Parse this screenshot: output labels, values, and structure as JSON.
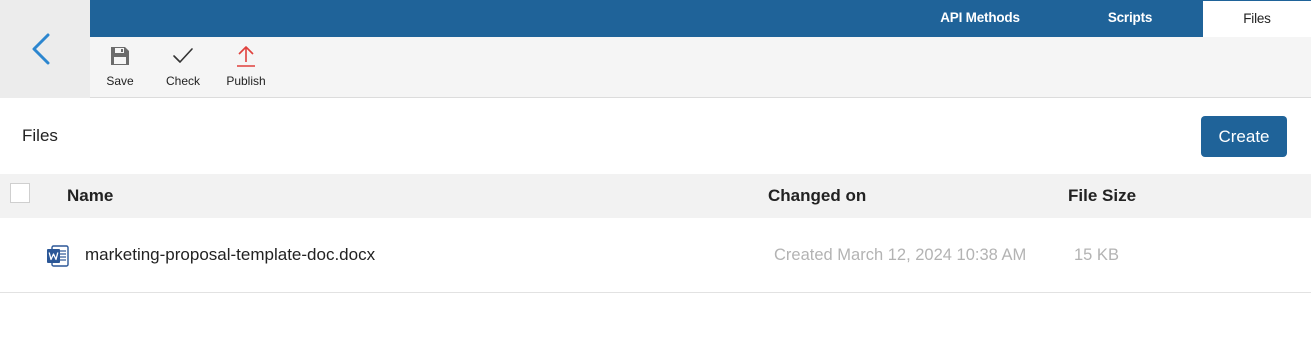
{
  "nav": {
    "back_icon": "chevron-left-icon"
  },
  "tabs": [
    {
      "label": "API Methods",
      "active": false
    },
    {
      "label": "Scripts",
      "active": false
    },
    {
      "label": "Files",
      "active": true
    }
  ],
  "toolbar": {
    "save_label": "Save",
    "save_icon": "floppy-disk-icon",
    "check_label": "Check",
    "check_icon": "checkmark-icon",
    "publish_label": "Publish",
    "publish_icon": "upload-arrow-icon"
  },
  "section": {
    "title": "Files",
    "create_label": "Create"
  },
  "table": {
    "columns": [
      "Name",
      "Changed on",
      "File Size"
    ],
    "rows": [
      {
        "icon": "word-document-icon",
        "name": "marketing-proposal-template-doc.docx",
        "changed": "Created March 12, 2024 10:38 AM",
        "size": "15 KB"
      }
    ]
  },
  "colors": {
    "brand": "#1f6399",
    "muted_text": "#b3b3b3",
    "publish_accent": "#e0403c"
  }
}
